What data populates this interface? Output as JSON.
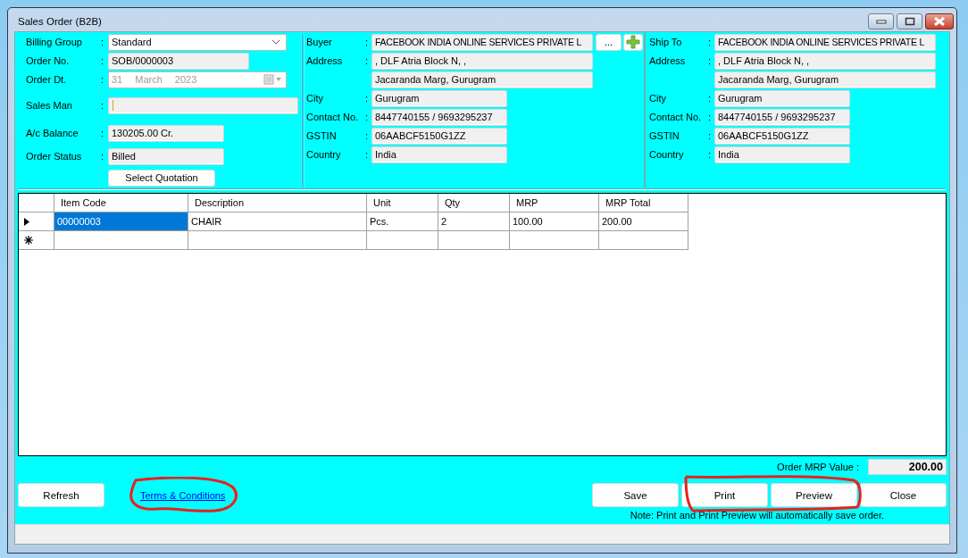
{
  "window": {
    "title": "Sales Order (B2B)"
  },
  "order": {
    "fields": [
      {
        "kind": "dropdown",
        "label": "Billing Group",
        "colon": ":",
        "value": "Standard"
      },
      {
        "kind": "text",
        "label": "Order No.",
        "colon": ":",
        "value": "SOB/0000003"
      },
      {
        "kind": "date",
        "label": "Order Dt.",
        "colon": ":",
        "day": "31",
        "month": "March",
        "year": "2023",
        "disabled": true
      },
      {
        "kind": "text",
        "label": "Sales Man",
        "colon": ":",
        "focused": true
      },
      {
        "kind": "text",
        "label": "A/c Balance",
        "colon": ":",
        "value": "130205.00 Cr."
      },
      {
        "kind": "text",
        "label": "Order Status",
        "colon": ":",
        "value": "Billed"
      }
    ],
    "select_button": "Select Quotation"
  },
  "buyer": {
    "browse_button": "...",
    "fields": [
      {
        "kind": "name",
        "label": "Buyer",
        "colon": ":",
        "value": "FACEBOOK INDIA ONLINE SERVICES PRIVATE L"
      },
      {
        "kind": "address",
        "label": "Address",
        "colon": ":",
        "lines": [
          ", DLF Atria Block N, ,",
          "Jacaranda Marg, Gurugram"
        ]
      },
      {
        "kind": "text",
        "label": "City",
        "colon": ":",
        "value": "Gurugram"
      },
      {
        "kind": "text",
        "label": "Contact No.",
        "colon": ":",
        "value": "8447740155 / 9693295237"
      },
      {
        "kind": "text",
        "label": "GSTIN",
        "colon": ":",
        "value": "06AABCF5150G1ZZ"
      },
      {
        "kind": "text",
        "label": "Country",
        "colon": ":",
        "value": "India"
      }
    ]
  },
  "ship_to": {
    "fields": [
      {
        "kind": "name",
        "label": "Ship To",
        "colon": ":",
        "value": "FACEBOOK INDIA ONLINE SERVICES PRIVATE L"
      },
      {
        "kind": "address",
        "label": "Address",
        "colon": ":",
        "lines": [
          ", DLF Atria Block N, ,",
          "Jacaranda Marg, Gurugram"
        ]
      },
      {
        "kind": "text",
        "label": "City",
        "colon": ":",
        "value": "Gurugram"
      },
      {
        "kind": "text",
        "label": "Contact No.",
        "colon": ":",
        "value": "8447740155 / 9693295237"
      },
      {
        "kind": "text",
        "label": "GSTIN",
        "colon": ":",
        "value": "06AABCF5150G1ZZ"
      },
      {
        "kind": "text",
        "label": "Country",
        "colon": ":",
        "value": "India"
      }
    ]
  },
  "table": {
    "columns": [
      "Item Code",
      "Description",
      "Unit",
      "Qty",
      "MRP",
      "MRP Total"
    ],
    "rows": [
      {
        "kind": "data",
        "current": true,
        "cells": [
          {
            "text": "00000003",
            "selected": true
          },
          {
            "text": "CHAIR",
            "selected": false
          },
          {
            "text": "Pcs.",
            "selected": false
          },
          {
            "text": "2",
            "selected": false
          },
          {
            "text": "100.00",
            "selected": false
          },
          {
            "text": "200.00",
            "selected": false
          }
        ]
      },
      {
        "kind": "new",
        "current": false
      }
    ]
  },
  "total": {
    "label": "Order MRP Value :",
    "value": "200.00"
  },
  "refresh_button": "Refresh",
  "terms_link": "Terms & Conditions",
  "buttons": [
    {
      "label": "Save",
      "disabled": false
    },
    {
      "label": "Print",
      "disabled": false
    },
    {
      "label": "Preview",
      "disabled": false
    },
    {
      "label": "Close",
      "disabled": false
    }
  ],
  "note": "Note: Print and Print Preview will automatically save order."
}
